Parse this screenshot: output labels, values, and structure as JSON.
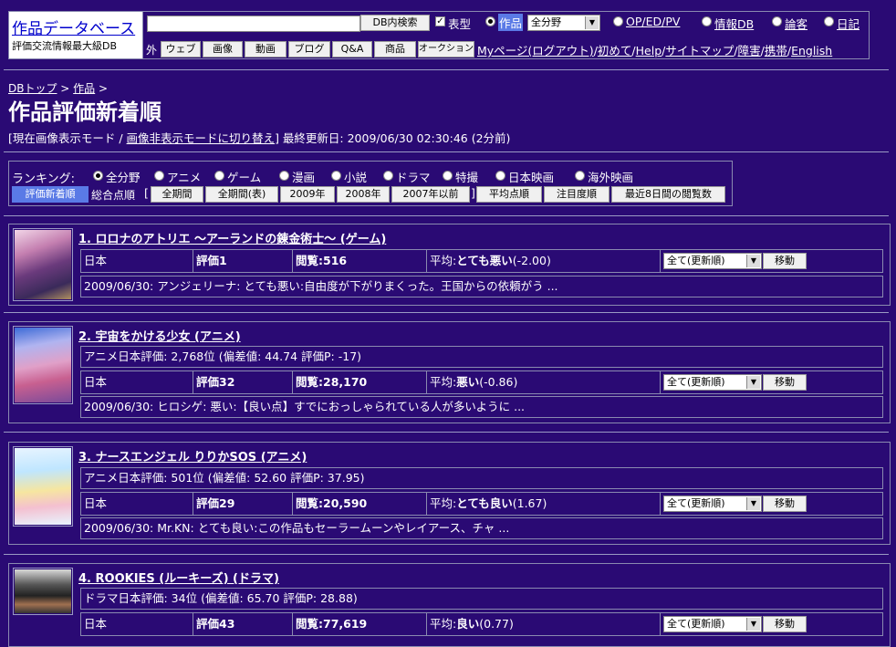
{
  "header": {
    "site_title": "作品データベース",
    "site_subtitle": "評価交流情報最大級DB",
    "search_value": "",
    "search_button": "DB内検索",
    "opt_table": "表型",
    "opt_works": "作品",
    "genre_select": "全分野",
    "opt_op": "OP/ED/PV",
    "opt_info": "情報DB",
    "opt_ronkaku": "論客",
    "opt_diary": "日記",
    "outer_label": "外",
    "tabs": [
      "ウェブ",
      "画像",
      "動画",
      "ブログ",
      "Q&A",
      "商品",
      "オークション"
    ],
    "nav_links": [
      "Myページ(ログアウト)",
      "初めて",
      "Help",
      "サイトマップ",
      "障害",
      "携帯",
      "English"
    ]
  },
  "breadcrumb": {
    "db_top": "DBトップ",
    "sep": " > ",
    "works": "作品",
    "tail": " >"
  },
  "page": {
    "title": "作品評価新着順",
    "mode_open": "[現在画像表示モード / ",
    "mode_switch": "画像非表示モードに切り替え",
    "mode_close": "] 最終更新日: 2009/06/30 02:30:46 (2分前)"
  },
  "ranking": {
    "label": "ランキング:",
    "genres": [
      "全分野",
      "アニメ",
      "ゲーム",
      "漫画",
      "小説",
      "ドラマ",
      "特撮",
      "日本映画",
      "海外映画"
    ],
    "tab_new": "評価新着順",
    "total_label": "総合点順",
    "bracket_open": "[",
    "periods": [
      "全期間",
      "全期間(表)",
      "2009年",
      "2008年",
      "2007年以前"
    ],
    "bracket_close": "]",
    "others": [
      "平均点順",
      "注目度順",
      "最近8日間の閲覧数"
    ]
  },
  "items": [
    {
      "title": "1. ロロナのアトリエ ～アーランドの錬金術士～ (ゲーム)",
      "rank_line": "",
      "region": "日本",
      "eval": "評価1",
      "views": "閲覧:516",
      "avg_prefix": "平均:",
      "avg_word": "とても悪い",
      "avg_num": "(-2.00)",
      "select": "全て(更新順)",
      "go": "移動",
      "comment": "2009/06/30: アンジェリーナ: とても悪い:自由度が下がりまくった。王国からの依頼がう ..."
    },
    {
      "title": "2. 宇宙をかける少女 (アニメ)",
      "rank_line": "アニメ日本評価: 2,768位 (偏差値: 44.74 評価P: -17)",
      "region": "日本",
      "eval": "評価32",
      "views": "閲覧:28,170",
      "avg_prefix": "平均:",
      "avg_word": "悪い",
      "avg_num": "(-0.86)",
      "select": "全て(更新順)",
      "go": "移動",
      "comment": "2009/06/30: ヒロシゲ: 悪い:【良い点】すでにおっしゃられている人が多いように ..."
    },
    {
      "title": "3. ナースエンジェル りりかSOS (アニメ)",
      "rank_line": "アニメ日本評価: 501位 (偏差値: 52.60 評価P: 37.95)",
      "region": "日本",
      "eval": "評価29",
      "views": "閲覧:20,590",
      "avg_prefix": "平均:",
      "avg_word": "とても良い",
      "avg_num": "(1.67)",
      "select": "全て(更新順)",
      "go": "移動",
      "comment": "2009/06/30: Mr.KN: とても良い:この作品もセーラームーンやレイアース、チャ ..."
    },
    {
      "title": "4. ROOKIES (ルーキーズ) (ドラマ)",
      "rank_line": "ドラマ日本評価: 34位 (偏差値: 65.70 評価P: 28.88)",
      "region": "日本",
      "eval": "評価43",
      "views": "閲覧:77,619",
      "avg_prefix": "平均:",
      "avg_word": "良い",
      "avg_num": "(0.77)",
      "select": "全て(更新順)",
      "go": "移動",
      "comment": ""
    }
  ],
  "colors": {
    "background": "#2a0a74",
    "active_tab": "#5a7ae6",
    "border": "#8a8ab0"
  }
}
